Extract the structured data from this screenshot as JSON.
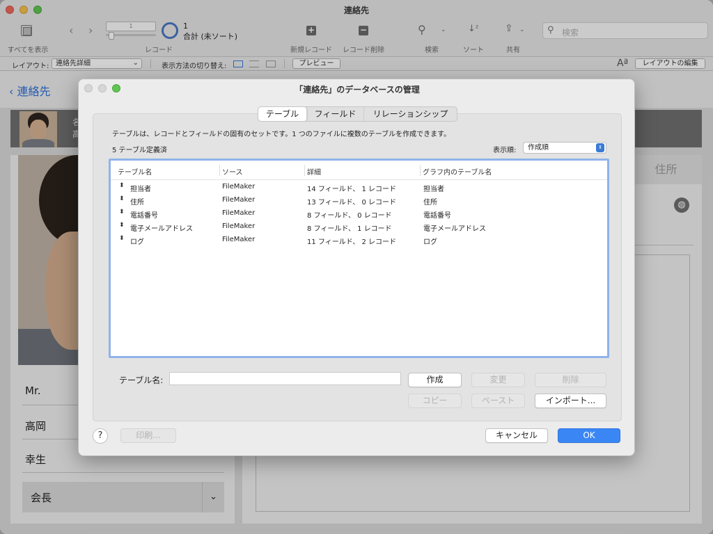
{
  "window": {
    "title": "連絡先"
  },
  "toolbar": {
    "show_all_label": "すべてを表示",
    "records_label": "レコード",
    "record_field_value": "1",
    "record_number": "1",
    "record_total": "合計 (未ソート)",
    "new_record_label": "新規レコード",
    "delete_record_label": "レコード削除",
    "find_label": "検索",
    "sort_label": "ソート",
    "share_label": "共有",
    "search_placeholder": "検索"
  },
  "layout_bar": {
    "layout_label": "レイアウト:",
    "layout_value": "連絡先詳細",
    "view_mode_label": "表示方法の切り替え:",
    "preview_label": "プレビュー",
    "edit_layout_label": "レイアウトの編集",
    "font_icon": "Aª"
  },
  "background": {
    "back_label": "連絡先",
    "header_line1": "名",
    "header_line2": "高",
    "salutation": "Mr.",
    "last_name": "高岡",
    "first_name": "幸生",
    "title_value": "会長",
    "right_tab": "住所"
  },
  "dialog": {
    "title": "「連絡先」のデータベースの管理",
    "tabs": [
      "テーブル",
      "フィールド",
      "リレーションシップ"
    ],
    "active_tab": "テーブル",
    "description": "テーブルは、レコードとフィールドの固有のセットです。1 つのファイルに複数のテーブルを作成できます。",
    "count_label": "5 テーブル定義済",
    "order_label": "表示順:",
    "order_value": "作成順",
    "columns": [
      "テーブル名",
      "ソース",
      "詳細",
      "グラフ内のテーブル名"
    ],
    "rows": [
      {
        "name": "担当者",
        "source": "FileMaker",
        "details": "14 フィールド、 1 レコード",
        "graph_name": "担当者"
      },
      {
        "name": "住所",
        "source": "FileMaker",
        "details": "13 フィールド、 0 レコード",
        "graph_name": "住所"
      },
      {
        "name": "電話番号",
        "source": "FileMaker",
        "details": "8 フィールド、 0 レコード",
        "graph_name": "電話番号"
      },
      {
        "name": "電子メールアドレス",
        "source": "FileMaker",
        "details": "8 フィールド、 1 レコード",
        "graph_name": "電子メールアドレス"
      },
      {
        "name": "ログ",
        "source": "FileMaker",
        "details": "11 フィールド、 2 レコード",
        "graph_name": "ログ"
      }
    ],
    "table_name_label": "テーブル名:",
    "table_name_value": "",
    "create_label": "作成",
    "change_label": "変更",
    "delete_label": "削除",
    "copy_label": "コピー",
    "paste_label": "ペースト",
    "import_label": "インポート...",
    "help_label": "?",
    "print_label": "印刷...",
    "cancel_label": "キャンセル",
    "ok_label": "OK"
  }
}
